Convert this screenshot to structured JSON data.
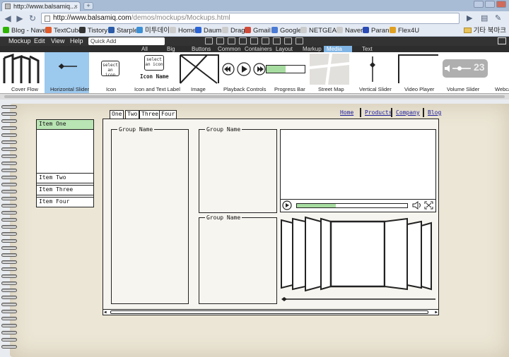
{
  "browser": {
    "tab_title": "http://www.balsamiq....",
    "url_host": "http://www.balsamiq.com",
    "url_path": "/demos/mockups/Mockups.html",
    "bookmarks": [
      {
        "label": "Blog - Naver",
        "color": "#2db400"
      },
      {
        "label": "TextCube",
        "color": "#e05a2a"
      },
      {
        "label": "Tistory",
        "color": "#333333"
      },
      {
        "label": "Starple",
        "color": "#2a5aa8"
      },
      {
        "label": "미투데이",
        "color": "#3a8fd6"
      },
      {
        "label": "Home",
        "color": "#cccccc"
      },
      {
        "label": "Daum",
        "color": "#2a63d6"
      },
      {
        "label": "Drag",
        "color": "#cccccc"
      },
      {
        "label": "Gmail",
        "color": "#d04a3a"
      },
      {
        "label": "Google",
        "color": "#4a7ad6"
      },
      {
        "label": "NETGEAR",
        "color": "#cccccc"
      },
      {
        "label": "Naver",
        "color": "#cccccc"
      },
      {
        "label": "Paran",
        "color": "#2a4ab6"
      },
      {
        "label": "Flex4U",
        "color": "#e0a020"
      }
    ],
    "other_bookmarks": "기타 북마크"
  },
  "app": {
    "menu": [
      "Mockup",
      "Edit",
      "View",
      "Help"
    ],
    "quick_add_placeholder": "Quick Add",
    "categories": [
      "All",
      "Big",
      "Buttons",
      "Common",
      "Containers",
      "Layout",
      "Markup",
      "Media",
      "Text"
    ],
    "active_category": "Media",
    "library": [
      {
        "label": "Cover Flow"
      },
      {
        "label": "Horizontal Slider",
        "selected": true
      },
      {
        "label": "Icon",
        "caption": "select an icon"
      },
      {
        "label": "Icon and Text Label",
        "caption": "select an icon",
        "name": "Icon Name"
      },
      {
        "label": "Image"
      },
      {
        "label": "Playback Controls"
      },
      {
        "label": "Progress Bar"
      },
      {
        "label": "Street Map"
      },
      {
        "label": "Vertical Slider"
      },
      {
        "label": "Video Player"
      },
      {
        "label": "Volume Slider"
      },
      {
        "label": "Webca"
      }
    ],
    "overlay_time": "23"
  },
  "mockup": {
    "tabs": [
      "One",
      "Two",
      "Three",
      "Four"
    ],
    "links": [
      "Home",
      "Products",
      "Company",
      "Blog"
    ],
    "list_items": [
      "Item One",
      "Item Two",
      "Item Three",
      "Item Four"
    ],
    "group_name": "Group Name",
    "video_progress": 0.35
  }
}
